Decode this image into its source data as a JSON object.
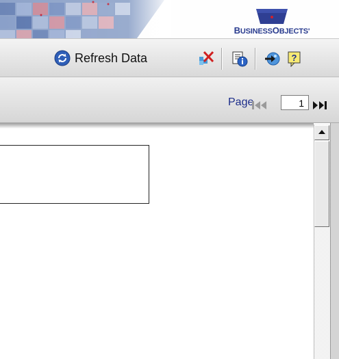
{
  "banner": {
    "logo_text": "BUSINESSOBJECTS",
    "logo_part1": "B",
    "logo_part2": "USINESS",
    "logo_part3": "O",
    "logo_part4": "BJECTS",
    "logo_mark": "'"
  },
  "toolbar": {
    "refresh_label": "Refresh Data",
    "icons": [
      "refresh-icon",
      "purge-icon",
      "properties-icon",
      "drill-icon",
      "help-icon"
    ]
  },
  "pagination": {
    "label": "Page",
    "current_page": "1"
  },
  "colors": {
    "logo_blue": "#2a3c8f",
    "page_label": "#1c2d8a"
  }
}
